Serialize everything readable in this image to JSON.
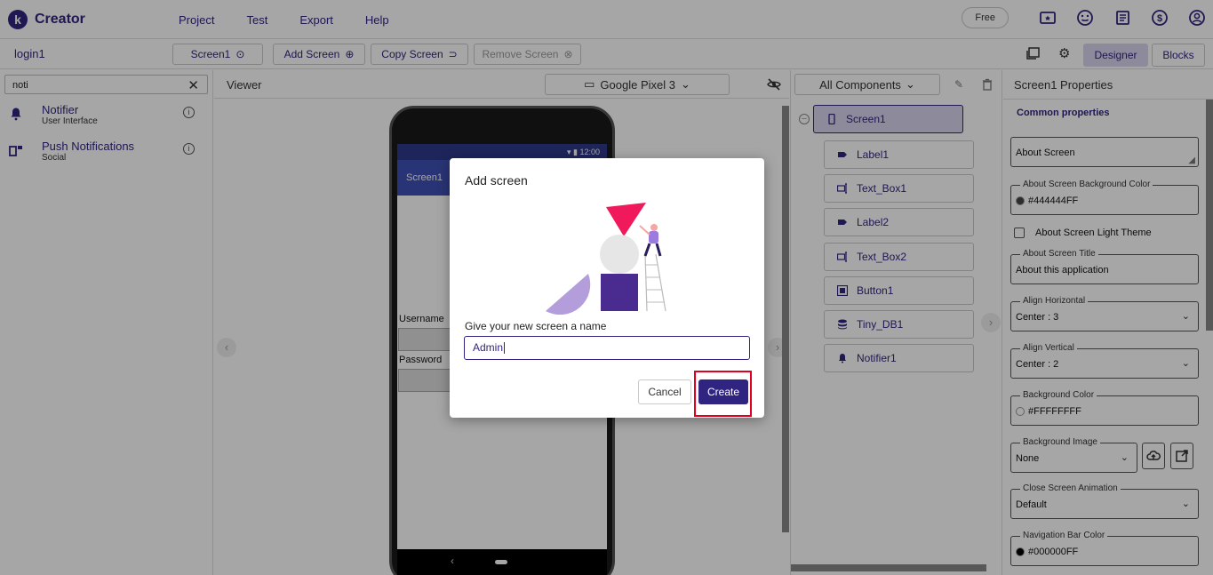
{
  "app": {
    "logo_letter": "k",
    "name": "Creator"
  },
  "menu": [
    "Project",
    "Test",
    "Export",
    "Help"
  ],
  "top_right": {
    "plan_label": "Free"
  },
  "toolbar": {
    "project_name": "login1",
    "screen_selector": "Screen1",
    "add_screen": "Add Screen",
    "copy_screen": "Copy Screen",
    "remove_screen": "Remove Screen",
    "designer_tab": "Designer",
    "blocks_tab": "Blocks"
  },
  "palette": {
    "search_value": "noti",
    "items": [
      {
        "name": "Notifier",
        "category": "User Interface",
        "icon": "bell-icon"
      },
      {
        "name": "Push Notifications",
        "category": "Social",
        "icon": "push-notification-icon"
      }
    ]
  },
  "viewer": {
    "label": "Viewer",
    "device": "Google Pixel 3",
    "phone": {
      "time": "12:00",
      "title": "Screen1",
      "fields": [
        "Username",
        "Password"
      ]
    }
  },
  "components": {
    "filter": "All Components",
    "root": "Screen1",
    "items": [
      {
        "name": "Label1",
        "icon": "label-icon"
      },
      {
        "name": "Text_Box1",
        "icon": "textbox-icon"
      },
      {
        "name": "Label2",
        "icon": "label-icon"
      },
      {
        "name": "Text_Box2",
        "icon": "textbox-icon"
      },
      {
        "name": "Button1",
        "icon": "button-icon"
      },
      {
        "name": "Tiny_DB1",
        "icon": "database-icon"
      },
      {
        "name": "Notifier1",
        "icon": "bell-icon"
      }
    ]
  },
  "properties": {
    "title": "Screen1 Properties",
    "section": "Common properties",
    "about_screen": "About Screen",
    "about_bg_color": {
      "label": "About Screen Background Color",
      "value": "#444444FF",
      "swatch": "#444444"
    },
    "light_theme": "About Screen Light Theme",
    "about_title": {
      "label": "About Screen Title",
      "value": "About this application"
    },
    "align_horizontal": {
      "label": "Align Horizontal",
      "value": "Center : 3"
    },
    "align_vertical": {
      "label": "Align Vertical",
      "value": "Center : 2"
    },
    "background_color": {
      "label": "Background Color",
      "value": "#FFFFFFFF",
      "swatch": "#ffffff"
    },
    "background_image": {
      "label": "Background Image",
      "value": "None"
    },
    "close_animation": {
      "label": "Close Screen Animation",
      "value": "Default"
    },
    "nav_bar_color": {
      "label": "Navigation Bar Color",
      "value": "#000000FF",
      "swatch": "#000000"
    }
  },
  "dialog": {
    "title": "Add screen",
    "prompt": "Give your new screen a name",
    "input_value": "Admin",
    "cancel": "Cancel",
    "create": "Create"
  },
  "colors": {
    "brand": "#2f2580",
    "highlight": "#e1001f",
    "illus_pink": "#f0195c",
    "illus_purple": "#4a2c91"
  }
}
